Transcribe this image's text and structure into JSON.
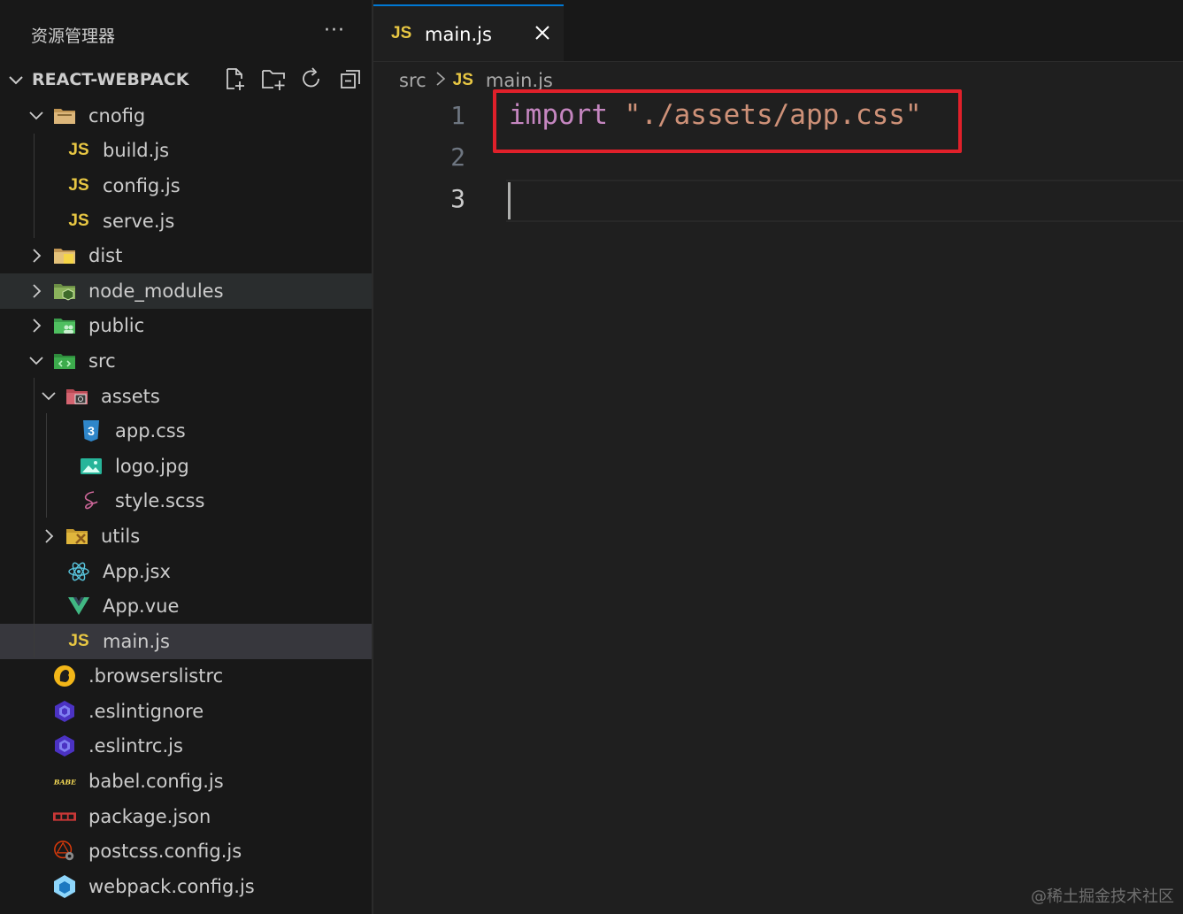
{
  "explorer": {
    "title": "资源管理器",
    "more": "···",
    "section_label": "REACT-WEBPACK",
    "toolbar": [
      "new-file",
      "new-folder",
      "refresh",
      "collapse-all"
    ]
  },
  "tree": [
    {
      "label": "cnofig",
      "depth": 1,
      "kind": "folder",
      "expanded": true,
      "icon": "folder-config-icon"
    },
    {
      "label": "build.js",
      "depth": 2,
      "kind": "file",
      "icon": "js-icon"
    },
    {
      "label": "config.js",
      "depth": 2,
      "kind": "file",
      "icon": "js-icon"
    },
    {
      "label": "serve.js",
      "depth": 2,
      "kind": "file",
      "icon": "js-icon"
    },
    {
      "label": "dist",
      "depth": 1,
      "kind": "folder",
      "expanded": false,
      "icon": "folder-dist-icon"
    },
    {
      "label": "node_modules",
      "depth": 1,
      "kind": "folder",
      "expanded": false,
      "icon": "folder-node-icon",
      "state": "hover"
    },
    {
      "label": "public",
      "depth": 1,
      "kind": "folder",
      "expanded": false,
      "icon": "folder-public-icon"
    },
    {
      "label": "src",
      "depth": 1,
      "kind": "folder",
      "expanded": true,
      "icon": "folder-src-icon"
    },
    {
      "label": "assets",
      "depth": 2,
      "kind": "folder",
      "expanded": true,
      "icon": "folder-assets-icon"
    },
    {
      "label": "app.css",
      "depth": 3,
      "kind": "file",
      "icon": "css-icon"
    },
    {
      "label": "logo.jpg",
      "depth": 3,
      "kind": "file",
      "icon": "image-icon"
    },
    {
      "label": "style.scss",
      "depth": 3,
      "kind": "file",
      "icon": "sass-icon"
    },
    {
      "label": "utils",
      "depth": 2,
      "kind": "folder",
      "expanded": false,
      "icon": "folder-utils-icon"
    },
    {
      "label": "App.jsx",
      "depth": 2,
      "kind": "file",
      "icon": "react-icon"
    },
    {
      "label": "App.vue",
      "depth": 2,
      "kind": "file",
      "icon": "vue-icon"
    },
    {
      "label": "main.js",
      "depth": 2,
      "kind": "file",
      "icon": "js-icon",
      "state": "selected"
    },
    {
      "label": ".browserslistrc",
      "depth": 1,
      "kind": "file",
      "icon": "browserslist-icon"
    },
    {
      "label": ".eslintignore",
      "depth": 1,
      "kind": "file",
      "icon": "eslint-icon"
    },
    {
      "label": ".eslintrc.js",
      "depth": 1,
      "kind": "file",
      "icon": "eslint-icon"
    },
    {
      "label": "babel.config.js",
      "depth": 1,
      "kind": "file",
      "icon": "babel-icon"
    },
    {
      "label": "package.json",
      "depth": 1,
      "kind": "file",
      "icon": "npm-icon"
    },
    {
      "label": "postcss.config.js",
      "depth": 1,
      "kind": "file",
      "icon": "postcss-icon"
    },
    {
      "label": "webpack.config.js",
      "depth": 1,
      "kind": "file",
      "icon": "webpack-icon"
    }
  ],
  "editor": {
    "tab": {
      "icon_text": "JS",
      "label": "main.js",
      "close": "×"
    },
    "breadcrumb": {
      "folder": "src",
      "icon_text": "JS",
      "file": "main.js"
    },
    "lines": [
      {
        "number": "1",
        "keyword": "import",
        "string": "\"./assets/app.css\""
      },
      {
        "number": "2"
      },
      {
        "number": "3",
        "active": true
      }
    ]
  },
  "watermark": "@稀土掘金技术社区",
  "colors": {
    "accent": "#0078d4",
    "highlight_box": "#e0202a",
    "keyword": "#c586c0",
    "string": "#ce9178",
    "js_icon": "#e8c743"
  }
}
